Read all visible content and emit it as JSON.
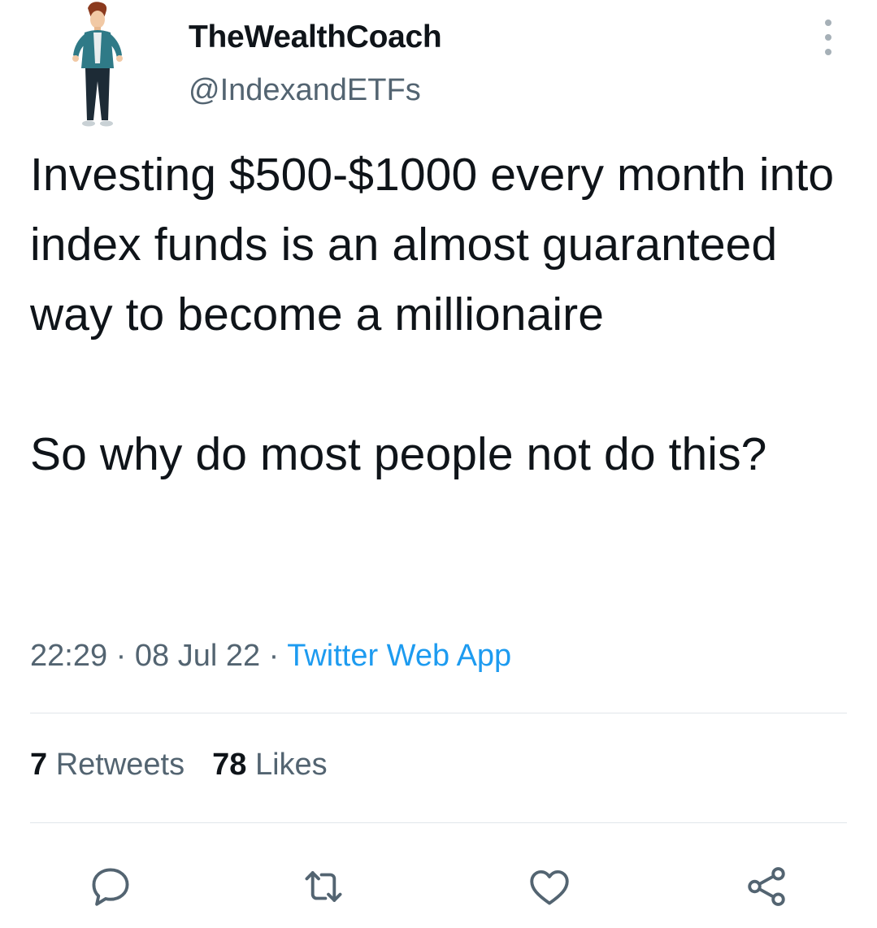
{
  "author": {
    "display_name": "TheWealthCoach",
    "handle": "@IndexandETFs"
  },
  "tweet": {
    "paragraphs": [
      "Investing $500-$1000 every month into index funds is an almost guaranteed way to become a millionaire",
      "So why do most people not do this?"
    ]
  },
  "meta": {
    "time": "22:29",
    "separator": " · ",
    "date": "08 Jul 22",
    "source": "Twitter Web App"
  },
  "stats": {
    "retweets_count": "7",
    "retweets_label": " Retweets",
    "likes_count": "78",
    "likes_label": " Likes"
  },
  "icons": {
    "avatar": "cartoon-man-avatar",
    "more": "more-vertical-icon",
    "reply": "reply-icon",
    "retweet": "retweet-icon",
    "like": "heart-icon",
    "share": "share-icon"
  },
  "colors": {
    "text": "#0f1419",
    "secondary": "#536471",
    "link": "#1d9bf0",
    "divider": "#e1e6ea"
  }
}
